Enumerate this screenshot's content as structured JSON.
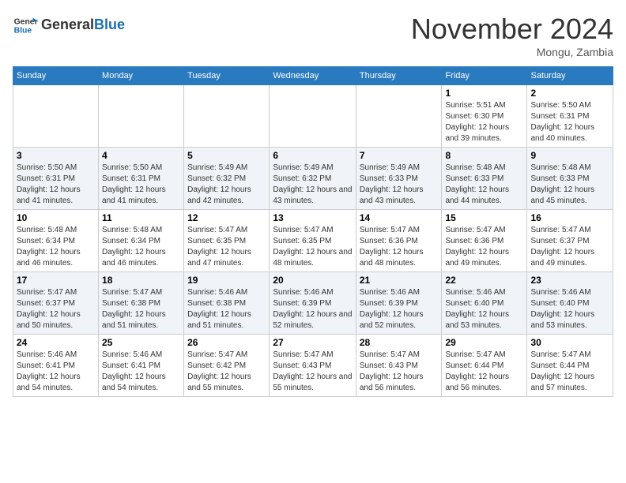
{
  "header": {
    "logo_general": "General",
    "logo_blue": "Blue",
    "month_title": "November 2024",
    "location": "Mongu, Zambia"
  },
  "weekdays": [
    "Sunday",
    "Monday",
    "Tuesday",
    "Wednesday",
    "Thursday",
    "Friday",
    "Saturday"
  ],
  "weeks": [
    [
      {
        "day": "",
        "info": ""
      },
      {
        "day": "",
        "info": ""
      },
      {
        "day": "",
        "info": ""
      },
      {
        "day": "",
        "info": ""
      },
      {
        "day": "",
        "info": ""
      },
      {
        "day": "1",
        "info": "Sunrise: 5:51 AM\nSunset: 6:30 PM\nDaylight: 12 hours and 39 minutes."
      },
      {
        "day": "2",
        "info": "Sunrise: 5:50 AM\nSunset: 6:31 PM\nDaylight: 12 hours and 40 minutes."
      }
    ],
    [
      {
        "day": "3",
        "info": "Sunrise: 5:50 AM\nSunset: 6:31 PM\nDaylight: 12 hours and 41 minutes."
      },
      {
        "day": "4",
        "info": "Sunrise: 5:50 AM\nSunset: 6:31 PM\nDaylight: 12 hours and 41 minutes."
      },
      {
        "day": "5",
        "info": "Sunrise: 5:49 AM\nSunset: 6:32 PM\nDaylight: 12 hours and 42 minutes."
      },
      {
        "day": "6",
        "info": "Sunrise: 5:49 AM\nSunset: 6:32 PM\nDaylight: 12 hours and 43 minutes."
      },
      {
        "day": "7",
        "info": "Sunrise: 5:49 AM\nSunset: 6:33 PM\nDaylight: 12 hours and 43 minutes."
      },
      {
        "day": "8",
        "info": "Sunrise: 5:48 AM\nSunset: 6:33 PM\nDaylight: 12 hours and 44 minutes."
      },
      {
        "day": "9",
        "info": "Sunrise: 5:48 AM\nSunset: 6:33 PM\nDaylight: 12 hours and 45 minutes."
      }
    ],
    [
      {
        "day": "10",
        "info": "Sunrise: 5:48 AM\nSunset: 6:34 PM\nDaylight: 12 hours and 46 minutes."
      },
      {
        "day": "11",
        "info": "Sunrise: 5:48 AM\nSunset: 6:34 PM\nDaylight: 12 hours and 46 minutes."
      },
      {
        "day": "12",
        "info": "Sunrise: 5:47 AM\nSunset: 6:35 PM\nDaylight: 12 hours and 47 minutes."
      },
      {
        "day": "13",
        "info": "Sunrise: 5:47 AM\nSunset: 6:35 PM\nDaylight: 12 hours and 48 minutes."
      },
      {
        "day": "14",
        "info": "Sunrise: 5:47 AM\nSunset: 6:36 PM\nDaylight: 12 hours and 48 minutes."
      },
      {
        "day": "15",
        "info": "Sunrise: 5:47 AM\nSunset: 6:36 PM\nDaylight: 12 hours and 49 minutes."
      },
      {
        "day": "16",
        "info": "Sunrise: 5:47 AM\nSunset: 6:37 PM\nDaylight: 12 hours and 49 minutes."
      }
    ],
    [
      {
        "day": "17",
        "info": "Sunrise: 5:47 AM\nSunset: 6:37 PM\nDaylight: 12 hours and 50 minutes."
      },
      {
        "day": "18",
        "info": "Sunrise: 5:47 AM\nSunset: 6:38 PM\nDaylight: 12 hours and 51 minutes."
      },
      {
        "day": "19",
        "info": "Sunrise: 5:46 AM\nSunset: 6:38 PM\nDaylight: 12 hours and 51 minutes."
      },
      {
        "day": "20",
        "info": "Sunrise: 5:46 AM\nSunset: 6:39 PM\nDaylight: 12 hours and 52 minutes."
      },
      {
        "day": "21",
        "info": "Sunrise: 5:46 AM\nSunset: 6:39 PM\nDaylight: 12 hours and 52 minutes."
      },
      {
        "day": "22",
        "info": "Sunrise: 5:46 AM\nSunset: 6:40 PM\nDaylight: 12 hours and 53 minutes."
      },
      {
        "day": "23",
        "info": "Sunrise: 5:46 AM\nSunset: 6:40 PM\nDaylight: 12 hours and 53 minutes."
      }
    ],
    [
      {
        "day": "24",
        "info": "Sunrise: 5:46 AM\nSunset: 6:41 PM\nDaylight: 12 hours and 54 minutes."
      },
      {
        "day": "25",
        "info": "Sunrise: 5:46 AM\nSunset: 6:41 PM\nDaylight: 12 hours and 54 minutes."
      },
      {
        "day": "26",
        "info": "Sunrise: 5:47 AM\nSunset: 6:42 PM\nDaylight: 12 hours and 55 minutes."
      },
      {
        "day": "27",
        "info": "Sunrise: 5:47 AM\nSunset: 6:43 PM\nDaylight: 12 hours and 55 minutes."
      },
      {
        "day": "28",
        "info": "Sunrise: 5:47 AM\nSunset: 6:43 PM\nDaylight: 12 hours and 56 minutes."
      },
      {
        "day": "29",
        "info": "Sunrise: 5:47 AM\nSunset: 6:44 PM\nDaylight: 12 hours and 56 minutes."
      },
      {
        "day": "30",
        "info": "Sunrise: 5:47 AM\nSunset: 6:44 PM\nDaylight: 12 hours and 57 minutes."
      }
    ]
  ]
}
